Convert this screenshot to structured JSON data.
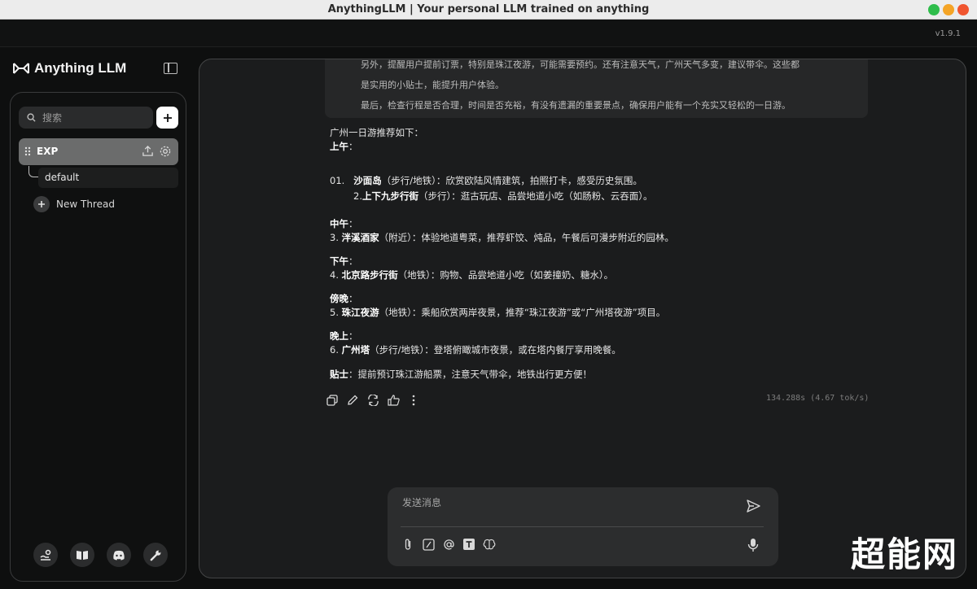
{
  "window": {
    "title": "AnythingLLM | Your personal LLM trained on anything",
    "version": "v1.9.1"
  },
  "brand": {
    "name": "Anything LLM"
  },
  "sidebar": {
    "search_placeholder": "搜索",
    "workspace": {
      "name": "EXP"
    },
    "thread": {
      "label": "default"
    },
    "new_thread_label": "New Thread",
    "footer_icons": [
      "community-hub-icon",
      "docs-book-icon",
      "discord-icon",
      "settings-wrench-icon"
    ]
  },
  "chat": {
    "thought_lines": [
      "另外，提醒用户提前订票，特别是珠江夜游，可能需要预约。还有注意天气，广州天气多变，建议带伞。这些都",
      "是实用的小贴士，能提升用户体验。",
      "最后，检查行程是否合理，时间是否充裕，有没有遗漏的重要景点，确保用户能有一个充实又轻松的一日游。"
    ],
    "answer": {
      "intro": "广州一日游推荐如下：",
      "morning_heading": "上午",
      "item1_num": "01.",
      "item1_title": "沙面岛",
      "item1_desc": "（步行/地铁）：欣赏欧陆风情建筑，拍照打卡，感受历史氛围。",
      "item2_num": "2.",
      "item2_title": "上下九步行街",
      "item2_desc": "（步行）：逛古玩店、品尝地道小吃（如肠粉、云吞面）。",
      "noon_heading": "中午",
      "item3_num": "3.",
      "item3_title": "泮溪酒家",
      "item3_desc": "（附近）：体验地道粤菜，推荐虾饺、炖品，午餐后可漫步附近的园林。",
      "afternoon_heading": "下午",
      "item4_num": "4.",
      "item4_title": "北京路步行街",
      "item4_desc": "（地铁）：购物、品尝地道小吃（如姜撞奶、糖水）。",
      "dusk_heading": "傍晚",
      "item5_num": "5.",
      "item5_title": "珠江夜游",
      "item5_desc": "（地铁）：乘船欣赏两岸夜景，推荐“珠江夜游”或“广州塔夜游”项目。",
      "evening_heading": "晚上",
      "item6_num": "6.",
      "item6_title": "广州塔",
      "item6_desc": "（步行/地铁）：登塔俯瞰城市夜景，或在塔内餐厅享用晚餐。",
      "tip_heading": "贴士",
      "tip_text": "：提前预订珠江游船票，注意天气带伞，地铁出行更方便！",
      "colon": "："
    },
    "stats": "134.288s (4.67 tok/s)"
  },
  "composer": {
    "placeholder": "发送消息"
  },
  "watermark": "超能网",
  "colors": {
    "background": "#0e0f0f",
    "panel": "#1b1c1d",
    "workspace_active": "#6b6c6c",
    "composer": "#2c2d2e"
  }
}
